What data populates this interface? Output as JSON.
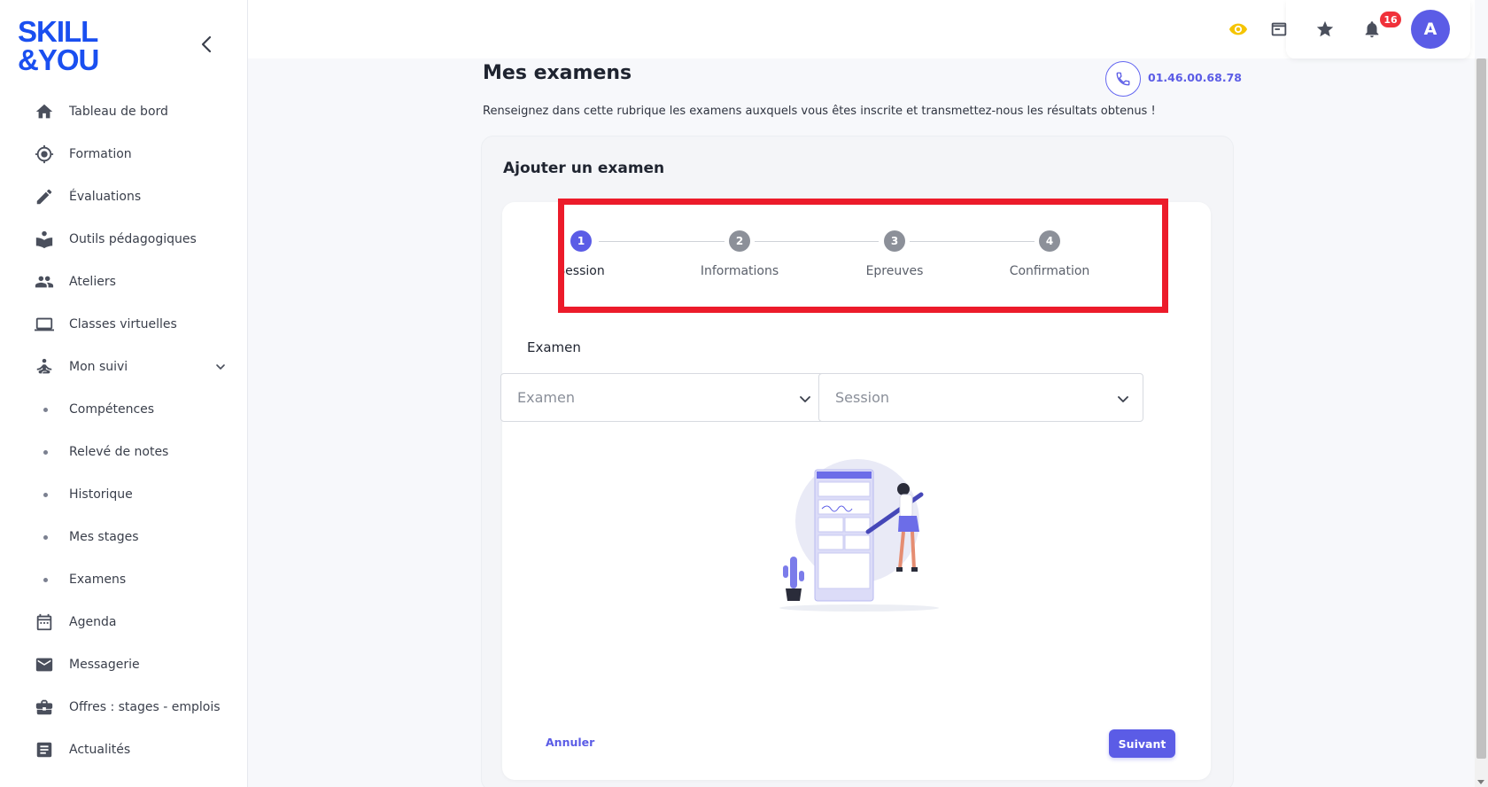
{
  "brand": {
    "line1": "SKILL",
    "line2": "&YOU"
  },
  "sidebar": {
    "items": [
      {
        "label": "Tableau de bord",
        "icon": "home-icon"
      },
      {
        "label": "Formation",
        "icon": "target-icon"
      },
      {
        "label": "Évaluations",
        "icon": "pencil-icon"
      },
      {
        "label": "Outils pédagogiques",
        "icon": "reading-icon"
      },
      {
        "label": "Ateliers",
        "icon": "people-icon"
      },
      {
        "label": "Classes virtuelles",
        "icon": "laptop-icon"
      },
      {
        "label": "Mon suivi",
        "icon": "meditation-icon",
        "expanded": true
      }
    ],
    "sub_items": [
      "Compétences",
      "Relevé de notes",
      "Historique",
      "Mes stages",
      "Examens"
    ],
    "items_after": [
      {
        "label": "Agenda",
        "icon": "calendar-icon"
      },
      {
        "label": "Messagerie",
        "icon": "mail-icon"
      },
      {
        "label": "Offres : stages - emplois",
        "icon": "briefcase-icon"
      },
      {
        "label": "Actualités",
        "icon": "article-icon"
      }
    ]
  },
  "topbar": {
    "notification_count": "16",
    "avatar_initial": "A",
    "colors": {
      "eye": "#f5c400",
      "accent": "#5b5ce6",
      "badge": "#f0313a"
    }
  },
  "page": {
    "title": "Mes examens",
    "phone": "01.46.00.68.78",
    "description": "Renseignez dans cette rubrique les examens auxquels vous êtes inscrite et transmettez-nous les résultats obtenus !"
  },
  "form": {
    "card_title": "Ajouter un examen",
    "steps": [
      {
        "number": "1",
        "label": "Session",
        "active": true
      },
      {
        "number": "2",
        "label": "Informations",
        "active": false
      },
      {
        "number": "3",
        "label": "Epreuves",
        "active": false
      },
      {
        "number": "4",
        "label": "Confirmation",
        "active": false
      }
    ],
    "section_label": "Examen",
    "exam_select_placeholder": "Examen",
    "session_select_placeholder": "Session",
    "cancel_label": "Annuler",
    "next_label": "Suivant"
  }
}
